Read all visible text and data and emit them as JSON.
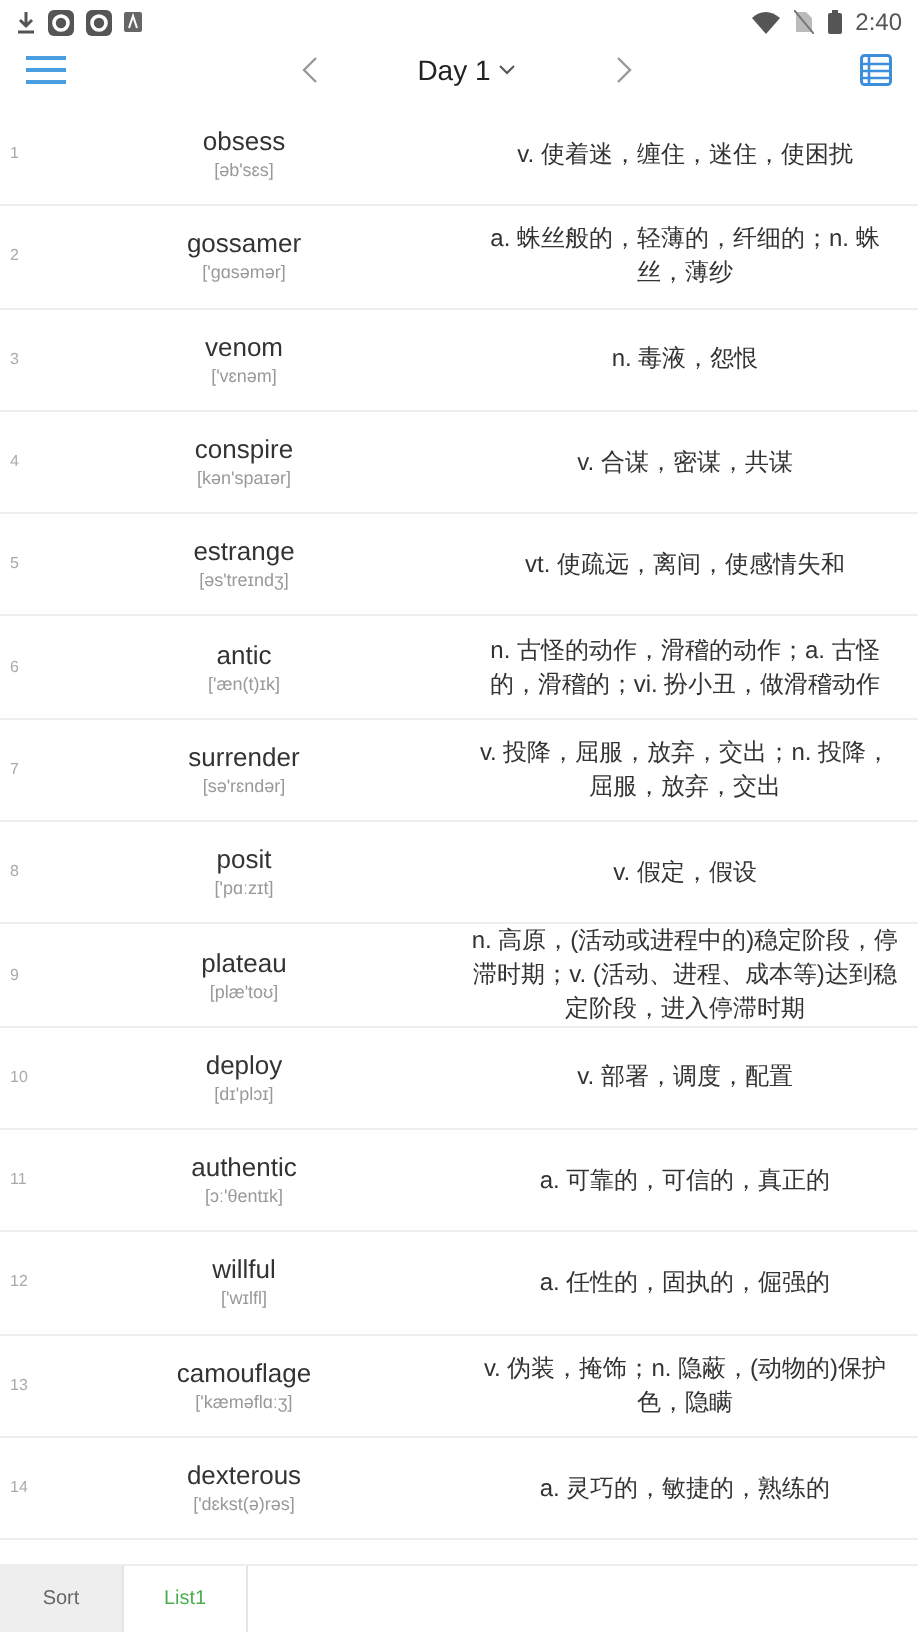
{
  "status_bar": {
    "time": "2:40"
  },
  "toolbar": {
    "title": "Day 1"
  },
  "words": [
    {
      "number": "1",
      "word": "obsess",
      "phonetic": "[əb'sɛs]",
      "definition": "v. 使着迷，缠住，迷住，使困扰"
    },
    {
      "number": "2",
      "word": "gossamer",
      "phonetic": "['gɑsəmər]",
      "definition": "a. 蛛丝般的，轻薄的，纤细的；n. 蛛丝，薄纱"
    },
    {
      "number": "3",
      "word": "venom",
      "phonetic": "['vɛnəm]",
      "definition": "n. 毒液，怨恨"
    },
    {
      "number": "4",
      "word": "conspire",
      "phonetic": "[kən'spaɪər]",
      "definition": "v. 合谋，密谋，共谋"
    },
    {
      "number": "5",
      "word": "estrange",
      "phonetic": "[əs'treɪndʒ]",
      "definition": "vt. 使疏远，离间，使感情失和"
    },
    {
      "number": "6",
      "word": "antic",
      "phonetic": "['æn(t)ɪk]",
      "definition": "n. 古怪的动作，滑稽的动作；a. 古怪的，滑稽的；vi. 扮小丑，做滑稽动作"
    },
    {
      "number": "7",
      "word": "surrender",
      "phonetic": "[sə'rɛndər]",
      "definition": "v. 投降，屈服，放弃，交出；n. 投降，屈服，放弃，交出"
    },
    {
      "number": "8",
      "word": "posit",
      "phonetic": "['pɑːzɪt]",
      "definition": "v. 假定，假设"
    },
    {
      "number": "9",
      "word": "plateau",
      "phonetic": "[plæ'toʊ]",
      "definition": "n. 高原，(活动或进程中的)稳定阶段，停滞时期；v. (活动、进程、成本等)达到稳定阶段，进入停滞时期"
    },
    {
      "number": "10",
      "word": "deploy",
      "phonetic": "[dɪ'plɔɪ]",
      "definition": "v. 部署，调度，配置"
    },
    {
      "number": "11",
      "word": "authentic",
      "phonetic": "[ɔː'θentɪk]",
      "definition": "a. 可靠的，可信的，真正的"
    },
    {
      "number": "12",
      "word": "willful",
      "phonetic": "['wɪlfl]",
      "definition": "a. 任性的，固执的，倔强的"
    },
    {
      "number": "13",
      "word": "camouflage",
      "phonetic": "['kæməflɑːʒ]",
      "definition": "v. 伪装，掩饰；n. 隐蔽，(动物的)保护色，隐瞒"
    },
    {
      "number": "14",
      "word": "dexterous",
      "phonetic": "['dɛkst(ə)rəs]",
      "definition": "a. 灵巧的，敏捷的，熟练的"
    }
  ],
  "bottom_tabs": [
    {
      "label": "Sort",
      "selected": false
    },
    {
      "label": "List1",
      "selected": true
    }
  ]
}
